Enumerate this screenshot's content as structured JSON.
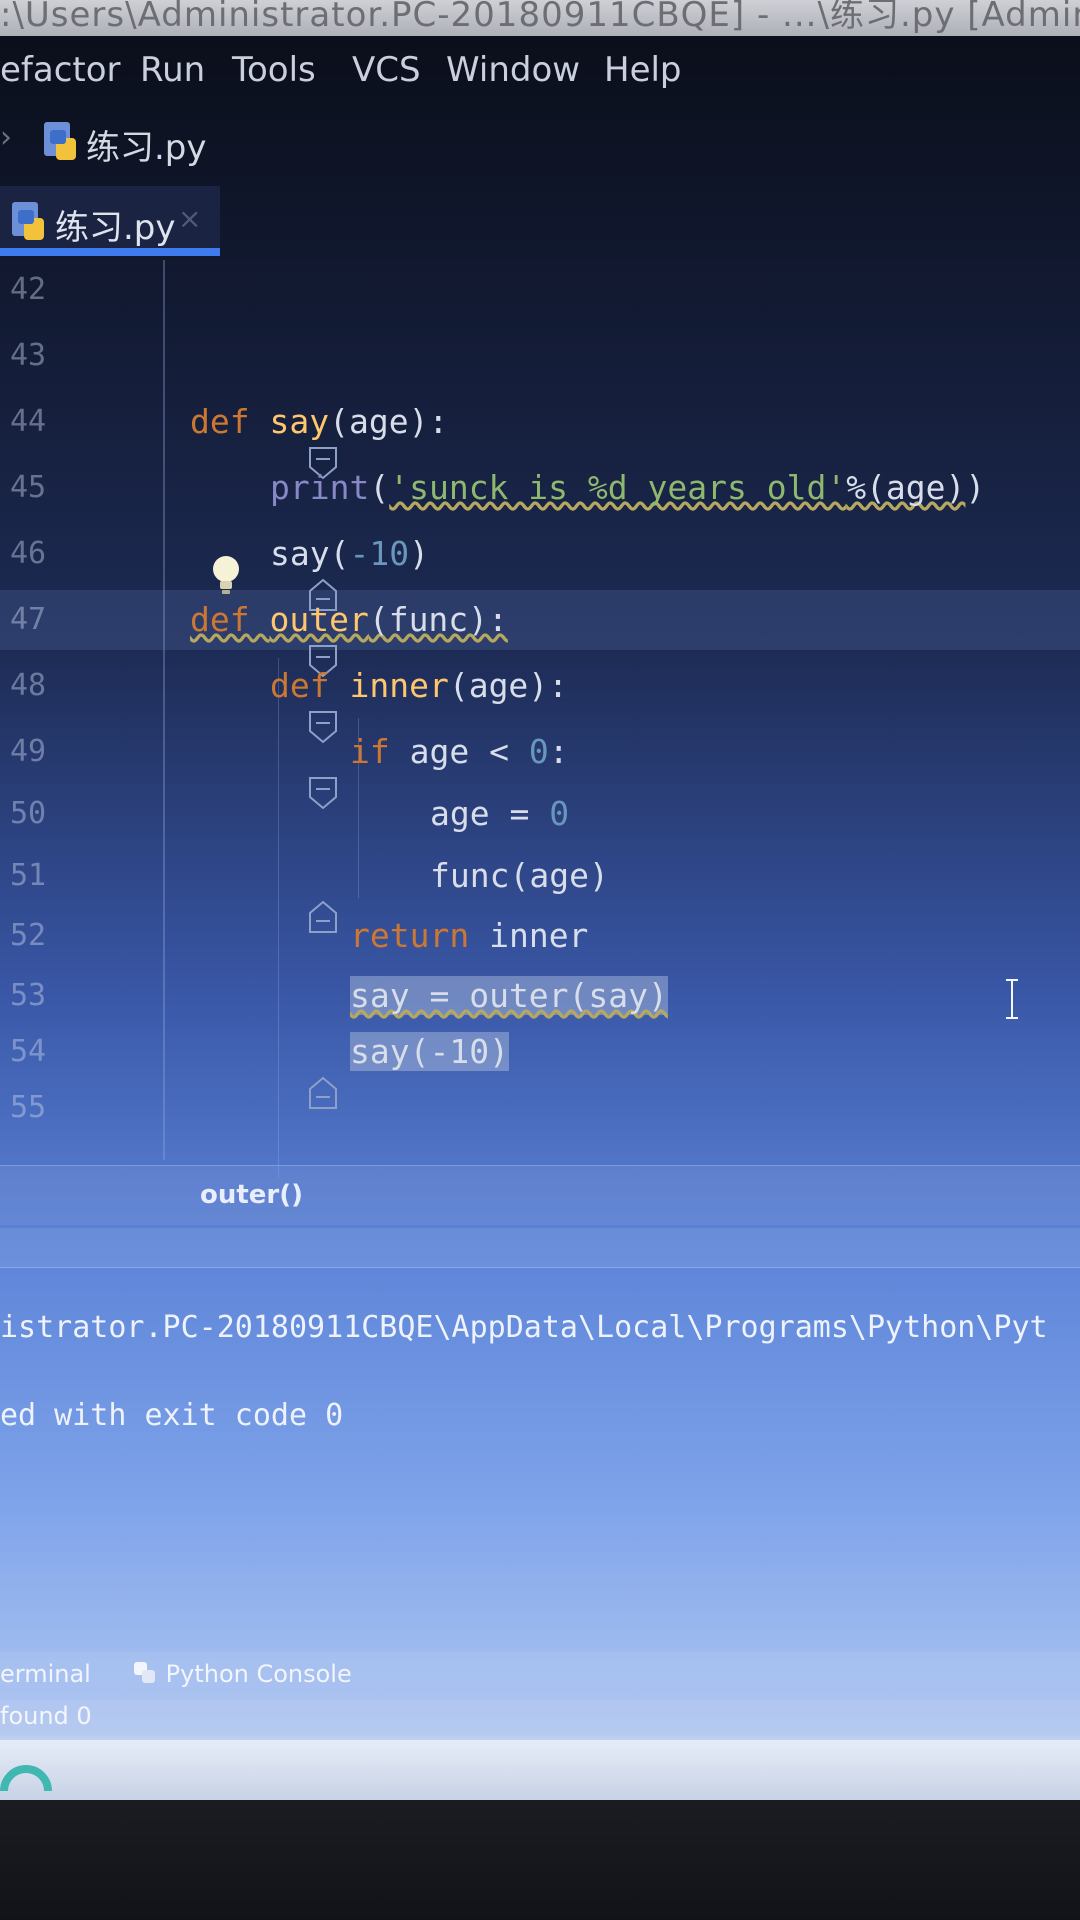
{
  "window": {
    "title": ":\\Users\\Administrator.PC-20180911CBQE] - ...\\练习.py [Administrator"
  },
  "menu": {
    "items": [
      "efactor",
      "Run",
      "Tools",
      "VCS",
      "Window",
      "Help"
    ]
  },
  "breadcrumb": {
    "file": "练习.py"
  },
  "tab": {
    "label": "练习.py",
    "close_glyph": "×"
  },
  "editor": {
    "lines": [
      {
        "number": "42"
      },
      {
        "number": "43"
      },
      {
        "number": "44",
        "tokens": [
          "def",
          " ",
          "say",
          "(age):"
        ]
      },
      {
        "number": "45",
        "tokens": [
          "print",
          "(",
          "'sunck is %d years old'",
          "%(age)",
          ")"
        ]
      },
      {
        "number": "46",
        "tokens": [
          "say(",
          "-10",
          ")"
        ]
      },
      {
        "number": "47",
        "tokens": [
          "def",
          " ",
          "outer",
          "(func):"
        ]
      },
      {
        "number": "48",
        "tokens": [
          "def",
          " ",
          "inner",
          "(age):"
        ]
      },
      {
        "number": "49",
        "tokens": [
          "if",
          " age < ",
          "0",
          ":"
        ]
      },
      {
        "number": "50",
        "tokens": [
          "age = ",
          "0"
        ]
      },
      {
        "number": "51",
        "tokens": [
          "func(age)"
        ]
      },
      {
        "number": "52",
        "tokens": [
          "return",
          " inner"
        ]
      },
      {
        "number": "53",
        "tokens": [
          "say = outer(say)"
        ]
      },
      {
        "number": "54",
        "tokens": [
          "say(-10)"
        ]
      },
      {
        "number": "55"
      }
    ],
    "structure_crumb": "outer()"
  },
  "console": {
    "lines": [
      "istrator.PC-20180911CBQE\\AppData\\Local\\Programs\\Python\\Pyt",
      "ed with exit code 0"
    ]
  },
  "tool_tabs": {
    "terminal": "erminal",
    "python_console": "Python Console"
  },
  "status": {
    "text": "found 0"
  },
  "colors": {
    "keyword": "#cc7832",
    "function": "#ffc66d",
    "number": "#6897bb",
    "string": "#8fb86f",
    "tab_accent": "#3d7bef"
  },
  "icons": [
    "python-file-icon",
    "lightbulb-icon",
    "fold-icon",
    "text-caret-icon",
    "python-console-icon"
  ]
}
